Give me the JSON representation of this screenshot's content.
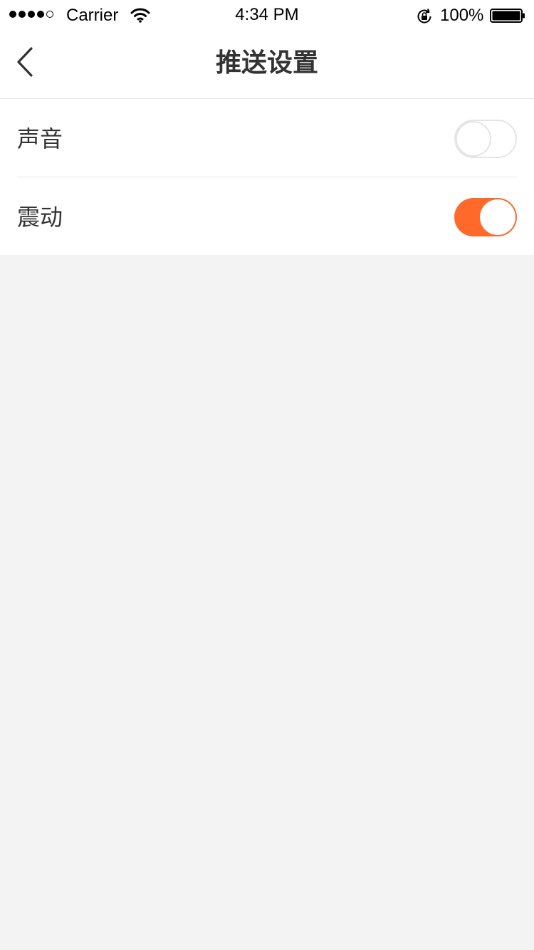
{
  "status_bar": {
    "carrier": "Carrier",
    "time": "4:34 PM",
    "battery": "100%",
    "signal_bars_filled": 4,
    "signal_bars_total": 5,
    "icons": [
      "wifi-icon",
      "rotation-lock-icon",
      "battery-icon"
    ]
  },
  "nav": {
    "title": "推送设置",
    "back_icon": "chevron-left-icon"
  },
  "settings": [
    {
      "label": "声音",
      "enabled": false
    },
    {
      "label": "震动",
      "enabled": true
    }
  ],
  "colors": {
    "accent": "#ff6a2a",
    "background": "#f3f3f3",
    "surface": "#ffffff",
    "text": "#333333",
    "divider": "#e8e8e8"
  }
}
